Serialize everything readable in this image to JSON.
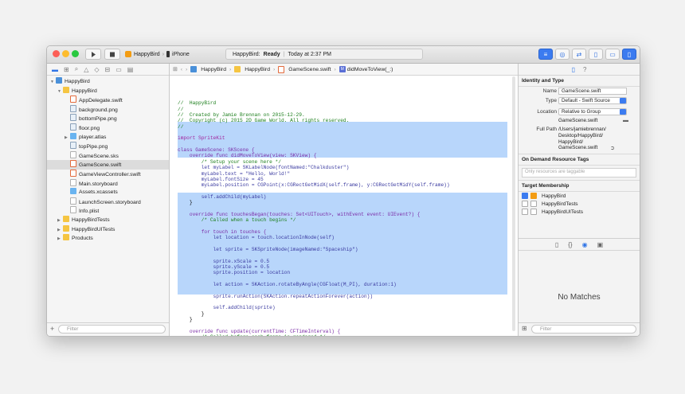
{
  "toolbar": {
    "scheme_app": "HappyBird",
    "scheme_device": "iPhone",
    "status_app": "HappyBird:",
    "status_state": "Ready",
    "status_time": "Today at 2:37 PM"
  },
  "navigator": {
    "items": [
      {
        "label": "HappyBird",
        "kind": "project",
        "indent": 0,
        "disclosure": "open"
      },
      {
        "label": "HappyBird",
        "kind": "folder",
        "indent": 1,
        "disclosure": "open"
      },
      {
        "label": "AppDelegate.swift",
        "kind": "swift",
        "indent": 2,
        "disclosure": ""
      },
      {
        "label": "background.png",
        "kind": "png",
        "indent": 2,
        "disclosure": ""
      },
      {
        "label": "bottomPipe.png",
        "kind": "png",
        "indent": 2,
        "disclosure": ""
      },
      {
        "label": "floor.png",
        "kind": "png",
        "indent": 2,
        "disclosure": ""
      },
      {
        "label": "player.atlas",
        "kind": "folder",
        "indent": 2,
        "disclosure": "closed"
      },
      {
        "label": "topPipe.png",
        "kind": "png",
        "indent": 2,
        "disclosure": ""
      },
      {
        "label": "GameScene.sks",
        "kind": "file",
        "indent": 2,
        "disclosure": ""
      },
      {
        "label": "GameScene.swift",
        "kind": "swift",
        "indent": 2,
        "disclosure": "",
        "selected": true
      },
      {
        "label": "GameViewController.swift",
        "kind": "swift",
        "indent": 2,
        "disclosure": ""
      },
      {
        "label": "Main.storyboard",
        "kind": "file",
        "indent": 2,
        "disclosure": ""
      },
      {
        "label": "Assets.xcassets",
        "kind": "folder",
        "indent": 2,
        "disclosure": ""
      },
      {
        "label": "LaunchScreen.storyboard",
        "kind": "file",
        "indent": 2,
        "disclosure": ""
      },
      {
        "label": "Info.plist",
        "kind": "file",
        "indent": 2,
        "disclosure": ""
      },
      {
        "label": "HappyBirdTests",
        "kind": "folder",
        "indent": 1,
        "disclosure": "closed"
      },
      {
        "label": "HappyBirdUITests",
        "kind": "folder",
        "indent": 1,
        "disclosure": "closed"
      },
      {
        "label": "Products",
        "kind": "folder",
        "indent": 1,
        "disclosure": "closed"
      }
    ],
    "filter_placeholder": "Filter"
  },
  "jumpbar": {
    "crumbs": [
      "HappyBird",
      "HappyBird",
      "GameScene.swift",
      "didMoveToView(_:)"
    ]
  },
  "code": {
    "lines": [
      {
        "t": "//  HappyBird",
        "c": "#1b7e1b"
      },
      {
        "t": "//",
        "c": "#1b7e1b"
      },
      {
        "t": "//  Created by Jamie Brennan on 2015-12-29.",
        "c": "#1b7e1b"
      },
      {
        "t": "//  Copyright (c) 2015 2D Game World. All rights reserved.",
        "c": "#1b7e1b"
      },
      {
        "t": "//",
        "c": "#1b7e1b"
      },
      {
        "t": "",
        "c": "#000"
      },
      {
        "t": "import SpriteKit",
        "c": "#a2239c"
      },
      {
        "t": "",
        "c": "#000"
      },
      {
        "t": "class GameScene: SKScene {",
        "c": "#7a2aa6"
      },
      {
        "t": "    override func didMoveToView(view: SKView) {",
        "c": "#7a2aa6"
      },
      {
        "t": "        /* Setup your scene here */",
        "c": "#1b7e1b"
      },
      {
        "t": "        let myLabel = SKLabelNode(fontNamed:\"Chalkduster\")",
        "c": "#3a3aa0"
      },
      {
        "t": "        myLabel.text = \"Hello, World!\"",
        "c": "#3a3aa0"
      },
      {
        "t": "        myLabel.fontSize = 45",
        "c": "#3a3aa0"
      },
      {
        "t": "        myLabel.position = CGPoint(x:CGRectGetMidX(self.frame), y:CGRectGetMidY(self.frame))",
        "c": "#3a3aa0"
      },
      {
        "t": "",
        "c": "#000"
      },
      {
        "t": "        self.addChild(myLabel)",
        "c": "#3a3aa0"
      },
      {
        "t": "    }",
        "c": "#000"
      },
      {
        "t": "",
        "c": "#000"
      },
      {
        "t": "    override func touchesBegan(touches: Set<UITouch>, withEvent event: UIEvent?) {",
        "c": "#7a2aa6"
      },
      {
        "t": "        /* Called when a touch begins */",
        "c": "#1b7e1b"
      },
      {
        "t": "",
        "c": "#000"
      },
      {
        "t": "        for touch in touches {",
        "c": "#7a2aa6"
      },
      {
        "t": "            let location = touch.locationInNode(self)",
        "c": "#3a3aa0"
      },
      {
        "t": "",
        "c": "#000"
      },
      {
        "t": "            let sprite = SKSpriteNode(imageNamed:\"Spaceship\")",
        "c": "#3a3aa0"
      },
      {
        "t": "",
        "c": "#000"
      },
      {
        "t": "            sprite.xScale = 0.5",
        "c": "#3a3aa0"
      },
      {
        "t": "            sprite.yScale = 0.5",
        "c": "#3a3aa0"
      },
      {
        "t": "            sprite.position = location",
        "c": "#3a3aa0"
      },
      {
        "t": "",
        "c": "#000"
      },
      {
        "t": "            let action = SKAction.rotateByAngle(CGFloat(M_PI), duration:1)",
        "c": "#3a3aa0"
      },
      {
        "t": "",
        "c": "#000"
      },
      {
        "t": "            sprite.runAction(SKAction.repeatActionForever(action))",
        "c": "#3a3aa0"
      },
      {
        "t": "",
        "c": "#000"
      },
      {
        "t": "            self.addChild(sprite)",
        "c": "#3a3aa0"
      },
      {
        "t": "        }",
        "c": "#000"
      },
      {
        "t": "    }",
        "c": "#000"
      },
      {
        "t": "",
        "c": "#000"
      },
      {
        "t": "    override func update(currentTime: CFTimeInterval) {",
        "c": "#7a2aa6"
      },
      {
        "t": "        /* Called before each frame is rendered */",
        "c": "#1b7e1b"
      },
      {
        "t": "    }",
        "c": "#000"
      },
      {
        "t": "}",
        "c": "#000"
      }
    ]
  },
  "inspector": {
    "identity_header": "Identity and Type",
    "name_label": "Name",
    "name_value": "GameScene.swift",
    "type_label": "Type",
    "type_value": "Default - Swift Source",
    "location_label": "Location",
    "location_value": "Relative to Group",
    "location_file": "GameScene.swift",
    "fullpath_label": "Full Path",
    "fullpath_lines": [
      "/Users/jamiebrennan/",
      "Desktop/HappyBird/",
      "HappyBird/",
      "GameScene.swift"
    ],
    "tags_header": "On Demand Resource Tags",
    "tags_placeholder": "Only resources are taggable",
    "membership_header": "Target Membership",
    "membership": [
      {
        "label": "HappyBird",
        "checked": true
      },
      {
        "label": "HappyBirdTests",
        "checked": false
      },
      {
        "label": "HappyBirdUITests",
        "checked": false
      }
    ],
    "no_matches": "No Matches",
    "filter_placeholder": "Filter"
  },
  "colors": {
    "accent": "#3b7bf0",
    "selection": "#b8d6fb"
  }
}
